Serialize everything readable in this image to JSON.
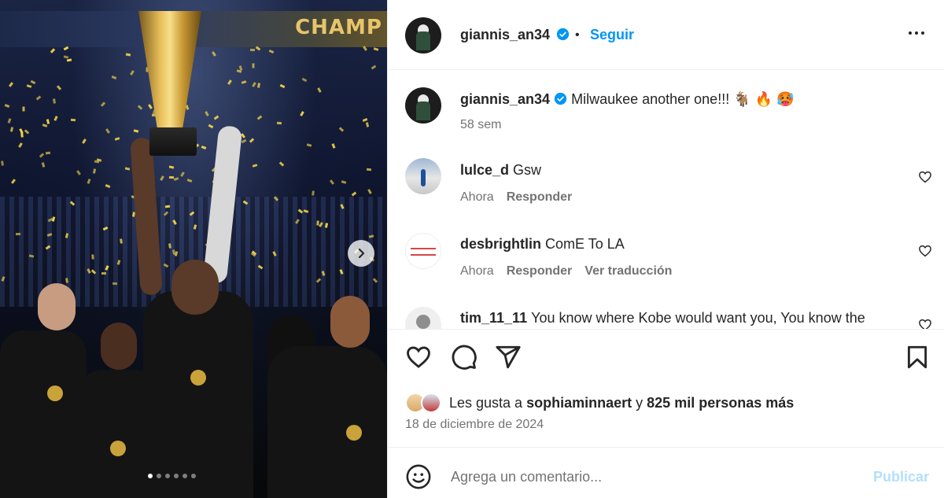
{
  "post": {
    "author": "giannis_an34",
    "follow_label": "Seguir",
    "separator": "•",
    "caption": "Milwaukee another one!!! 🐐 🔥 🥵",
    "caption_age": "58 sem",
    "banner_text": "CHAMP",
    "carousel_total": 6,
    "carousel_active": 0
  },
  "comments": [
    {
      "user": "lulce_d",
      "text": "Gsw",
      "time": "Ahora",
      "reply_label": "Responder",
      "translate_label": ""
    },
    {
      "user": "desbrightlin",
      "text": "ComE To LA",
      "time": "Ahora",
      "reply_label": "Responder",
      "translate_label": "Ver traducción"
    },
    {
      "user": "tim_11_11",
      "text": "You know where Kobe would want you, You know the"
    }
  ],
  "likes": {
    "prefix": "Les gusta a",
    "user": "sophiaminnaert",
    "connector": "y",
    "others": "825 mil personas más"
  },
  "date": "18 de diciembre de 2024",
  "composer": {
    "placeholder": "Agrega un comentario...",
    "publish_label": "Publicar"
  },
  "colors": {
    "accent": "#0095f6",
    "publish_disabled": "#b2dffc",
    "muted": "#737373",
    "confetti": "#f0d24a"
  },
  "icons": [
    "verified-badge-icon",
    "more-options-icon",
    "heart-icon",
    "comment-icon",
    "share-icon",
    "bookmark-icon",
    "emoji-icon",
    "chevron-right-icon"
  ]
}
